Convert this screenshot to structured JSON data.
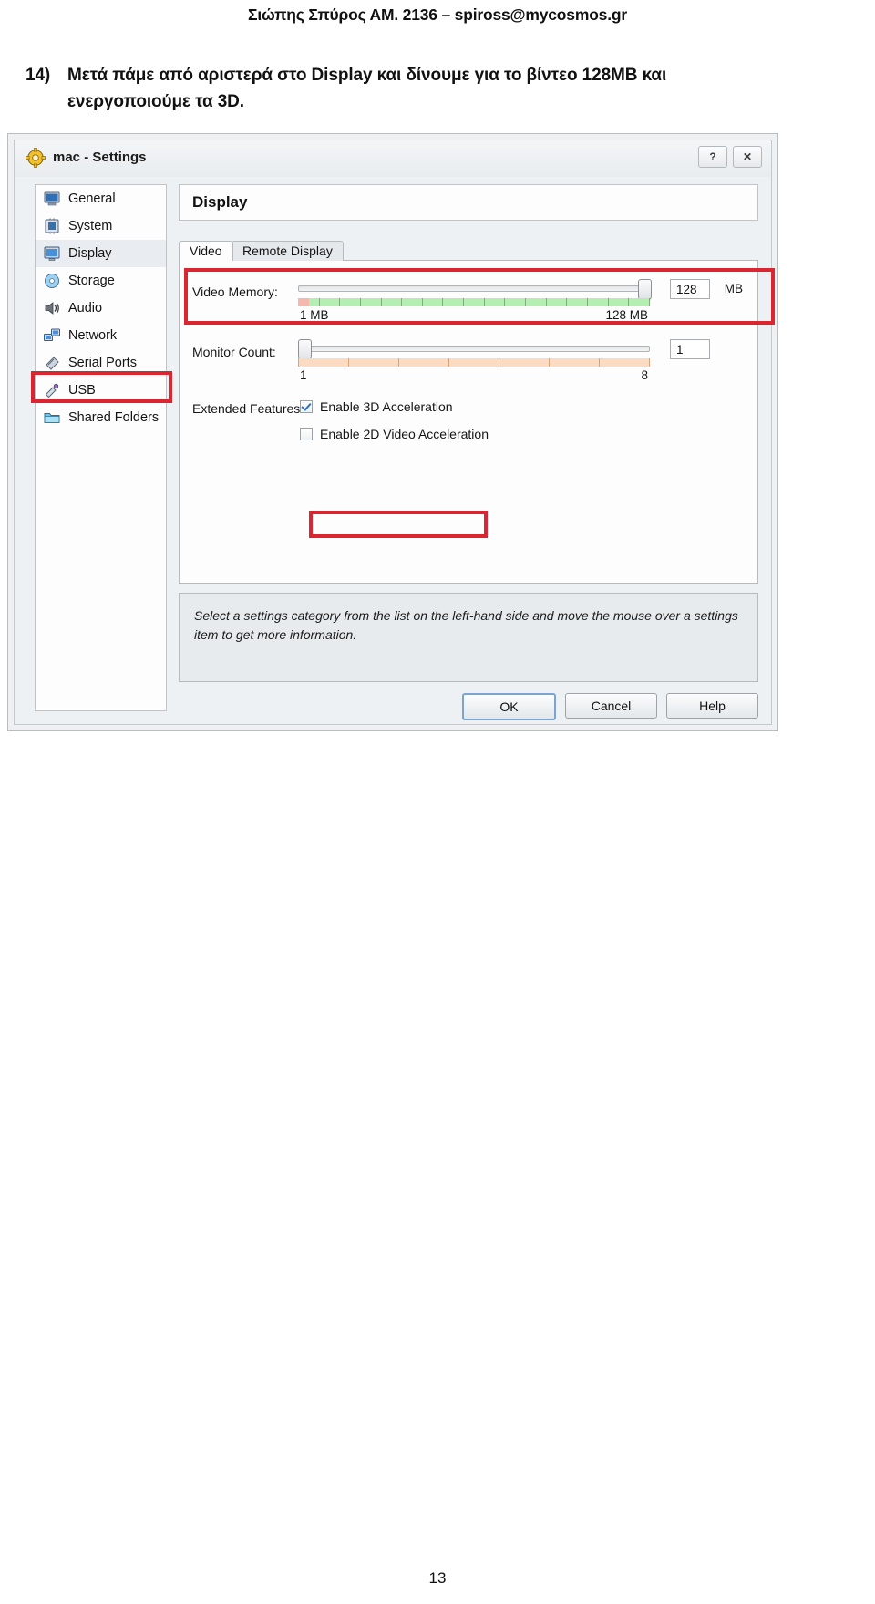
{
  "document": {
    "header": "Σιώπης Σπύρος ΑΜ. 2136 – spiross@mycosmos.gr",
    "page_number": "13",
    "instruction": {
      "number": "14)",
      "line1_before_bold": "Μετά πάμε από αριστερά στο ",
      "bold_term": "Display",
      "line1_after_bold": " και δίνουμε για το βίντεο 128MB και",
      "line2": "ενεργοποιούμε τα 3D."
    }
  },
  "window": {
    "title": "mac - Settings",
    "app_icon": "gear-icon",
    "help_button": "?",
    "close_button": "✕"
  },
  "sidebar": {
    "items": [
      {
        "label": "General",
        "icon": "monitor-icon",
        "selected": false
      },
      {
        "label": "System",
        "icon": "chip-icon",
        "selected": false
      },
      {
        "label": "Display",
        "icon": "display-icon",
        "selected": true
      },
      {
        "label": "Storage",
        "icon": "disc-icon",
        "selected": false
      },
      {
        "label": "Audio",
        "icon": "speaker-icon",
        "selected": false
      },
      {
        "label": "Network",
        "icon": "network-icon",
        "selected": false
      },
      {
        "label": "Serial Ports",
        "icon": "serial-port-icon",
        "selected": false
      },
      {
        "label": "USB",
        "icon": "usb-icon",
        "selected": false
      },
      {
        "label": "Shared Folders",
        "icon": "folder-icon",
        "selected": false
      }
    ]
  },
  "panel": {
    "title": "Display",
    "tabs": [
      {
        "label": "Video",
        "active": true
      },
      {
        "label": "Remote Display",
        "active": false
      }
    ],
    "video_memory": {
      "label": "Video Memory:",
      "min_label": "1 MB",
      "max_label": "128 MB",
      "value": "128",
      "unit": "MB",
      "fill_percent": 100
    },
    "monitor_count": {
      "label": "Monitor Count:",
      "min_label": "1",
      "max_label": "8",
      "value": "1",
      "fill_percent": 0
    },
    "extended_features": {
      "label": "Extended Features:",
      "options": [
        {
          "label": "Enable 3D Acceleration",
          "checked": true
        },
        {
          "label": "Enable 2D Video Acceleration",
          "checked": false
        }
      ]
    },
    "info_text": "Select a settings category from the list on the left-hand side and move the mouse over a settings item to get more information."
  },
  "buttons": {
    "ok": "OK",
    "cancel": "Cancel",
    "help": "Help"
  },
  "annotations": {
    "accent_color": "#d92631",
    "slider_green": "#b4eeb1",
    "slider_peach": "#fbdcc3"
  }
}
